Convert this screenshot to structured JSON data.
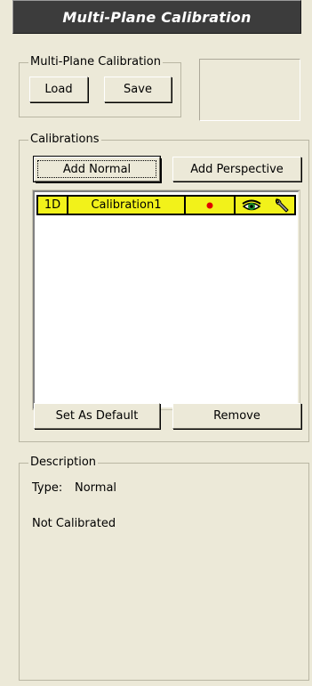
{
  "title": "Multi-Plane Calibration",
  "multiplane_group": {
    "label": "Multi-Plane Calibration",
    "load_label": "Load",
    "save_label": "Save"
  },
  "calibrations_group": {
    "label": "Calibrations",
    "add_normal_label": "Add Normal",
    "add_perspective_label": "Add Perspective",
    "rows": [
      {
        "type_code": "1D",
        "name": "Calibration1",
        "status_icon": "red-dot-icon",
        "view_icon": "eye-icon",
        "settings_icon": "wrench-icon"
      }
    ],
    "set_default_label": "Set As Default",
    "remove_label": "Remove"
  },
  "description_group": {
    "label": "Description",
    "type_label": "Type:",
    "type_value": "Normal",
    "status_text": "Not Calibrated"
  },
  "colors": {
    "row_highlight": "#F2F21A",
    "status_dot": "#E00000",
    "title_bg": "#3C3C3C"
  }
}
